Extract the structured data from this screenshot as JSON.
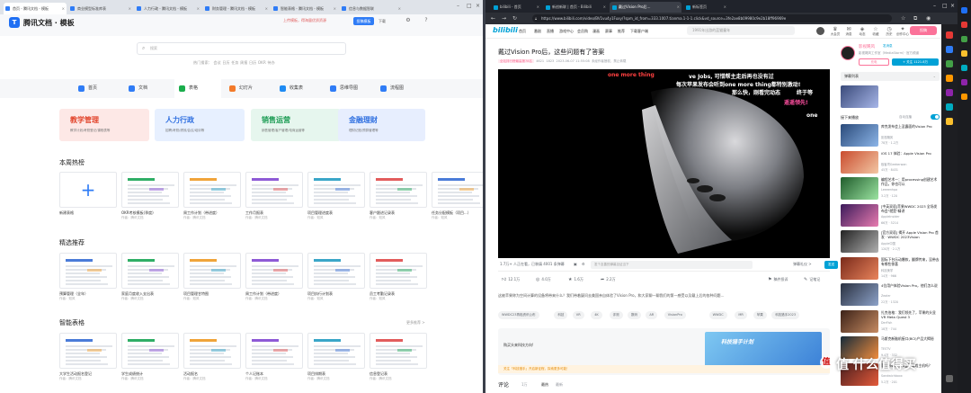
{
  "left_window": {
    "tabs": [
      {
        "label": "首页 - 腾讯文档 - 模板",
        "active": true
      },
      {
        "label": "商业模型标准库表",
        "active": false
      },
      {
        "label": "人力行政 - 腾讯文档 - 模板",
        "active": false
      },
      {
        "label": "财务管理 - 腾讯文档 - 模板",
        "active": false
      },
      {
        "label": "智能表格 - 腾讯文档 - 模板",
        "active": false
      },
      {
        "label": "信息与数据智联",
        "active": false
      }
    ],
    "app_name": "腾讯文档 · 模板",
    "header_hint": "上传模板，得海量优质资源",
    "submit_button": "投稿模板",
    "download_button": "下载",
    "search_placeholder": "搜索",
    "hot_searches": "热门搜索：  会议    日历    任务  周报   日历  OKR  待办",
    "categories": [
      {
        "label": "首页",
        "color": "#2f7cf6",
        "active": false
      },
      {
        "label": "文档",
        "color": "#2f7cf6",
        "active": false
      },
      {
        "label": "表格",
        "color": "#1aad4c",
        "active": true
      },
      {
        "label": "幻灯片",
        "color": "#f37a2a",
        "active": false
      },
      {
        "label": "收集表",
        "color": "#1f8bf3",
        "active": false
      },
      {
        "label": "思维导图",
        "color": "#2f7cf6",
        "active": false
      },
      {
        "label": "流程图",
        "color": "#2f7cf6",
        "active": false
      }
    ],
    "banners": [
      {
        "title": "教学管理",
        "sub": "教学计划/考勤登记/课程表等",
        "bg": "#fde8e6",
        "color": "#e2452c"
      },
      {
        "title": "人力行政",
        "sub": "招聘/考勤/绩效/会议/培训等",
        "bg": "#e7f0ff",
        "color": "#2f6fe0"
      },
      {
        "title": "销售运营",
        "sub": "销售管理/客户管理/电商运营等",
        "bg": "#e6f6ee",
        "color": "#1a9b52"
      },
      {
        "title": "金融理财",
        "sub": "理财记账/预算管理等",
        "bg": "#e7eefe",
        "color": "#2f6fe0"
      }
    ],
    "section_hot": "本周热榜",
    "hot_cards": [
      {
        "title": "新建表格",
        "meta": ""
      },
      {
        "title": "OKR考核模板(季度)",
        "meta": "作者：腾讯文档"
      },
      {
        "title": "周工作计划（带进度）",
        "meta": "作者：腾讯文档"
      },
      {
        "title": "工作月报表",
        "meta": "作者：腾讯文档"
      },
      {
        "title": "项目管理进度表",
        "meta": "作者：知风"
      },
      {
        "title": "客户跟进记录表",
        "meta": "作者：知风"
      },
      {
        "title": "任务分配模板（项目...）",
        "meta": "作者：知风"
      }
    ],
    "section_recommend": "精选推荐",
    "rec_cards": [
      {
        "title": "预算管理（全年）",
        "meta": "作者：知风"
      },
      {
        "title": "家庭月度收入支出表",
        "meta": "作者：腾讯文档"
      },
      {
        "title": "项目管理甘特图",
        "meta": "作者：知风"
      },
      {
        "title": "周工作计划（带进度）",
        "meta": "作者：腾讯文档"
      },
      {
        "title": "项目执行计划表",
        "meta": "作者：知风"
      },
      {
        "title": "员工考勤记录表",
        "meta": "作者：知风"
      }
    ],
    "section_smart": "智能表格",
    "more_link": "更多推荐 >",
    "smart_cards": [
      {
        "title": "大学生活动报名登记",
        "meta": "作者：腾讯文档"
      },
      {
        "title": "学生成绩统计",
        "meta": "作者：腾讯文档"
      },
      {
        "title": "活动报名",
        "meta": "作者：腾讯文档"
      },
      {
        "title": "个人记账本",
        "meta": "作者：腾讯文档"
      },
      {
        "title": "项目排期表",
        "meta": "作者：腾讯文档"
      },
      {
        "title": "信息登记表",
        "meta": "作者：腾讯文档"
      }
    ]
  },
  "right_window": {
    "tabs": [
      {
        "label": "bilibili - 首页",
        "active": false
      },
      {
        "label": "新创新联 | 首页 - Bilibili",
        "active": false
      },
      {
        "label": "戴过Vision Pro后…",
        "active": true
      },
      {
        "label": "新标签页",
        "active": false
      }
    ],
    "url": "https://www.bilibili.com/video/BV1vu4y1Fuxy/?spm_id_from=333.1007.tianma.1-1-1.click&vd_source=3fe2ae8b09980c9e2b18ff96969e",
    "logo": "bilibili",
    "nav_items": [
      "首页",
      "番剧",
      "直播",
      "游戏中心",
      "会员购",
      "漫画",
      "赛事",
      "推荐",
      "下载客户端"
    ],
    "search_placeholder": "1991年出游的蓝猫童年",
    "top_icons": [
      {
        "icon": "crown-icon",
        "label": "大会员"
      },
      {
        "icon": "message-icon",
        "label": "消息"
      },
      {
        "icon": "dynamic-icon",
        "label": "动态"
      },
      {
        "icon": "star-icon",
        "label": "收藏"
      },
      {
        "icon": "history-icon",
        "label": "历史"
      },
      {
        "icon": "bulb-icon",
        "label": "创作中心"
      }
    ],
    "upload_button": "投稿",
    "video": {
      "title": "戴过Vision Pro后，这些问题有了答案",
      "stats": "2023-06-07 11:55:08",
      "tag": "全站排行榜最高第78名",
      "views": "4621",
      "danmu": "1823",
      "no_repost": "未经作者授权，禁止转载"
    },
    "danmaku": [
      {
        "text": "one more thing",
        "color": "#ff4040"
      },
      {
        "text": "ve Jobs, 可惜帮主走后再也没有过",
        "color": "#ffffff"
      },
      {
        "text": "每次苹果发布会听到one more thing都特别激动!",
        "color": "#ffffff"
      },
      {
        "text": "那么快，刚看完动态",
        "color": "#ffffff"
      },
      {
        "text": "终于等",
        "color": "#ffffff"
      },
      {
        "text": "遥遥领先!",
        "color": "#ff4fa0"
      },
      {
        "text": "one",
        "color": "#ffffff"
      }
    ],
    "player_controls": {
      "watching": "1.7万+ 人正在看，已装填 4001 条弹幕",
      "input_placeholder": "发个友善的弹幕见证当下",
      "etiquette": "弹幕礼仪 >",
      "send": "发送"
    },
    "toolbar": [
      {
        "icon": "like-icon",
        "label": "12.1万"
      },
      {
        "icon": "coin-icon",
        "label": "4.0万"
      },
      {
        "icon": "fav-icon",
        "label": "1.6万"
      },
      {
        "icon": "share-icon",
        "label": "2.2万"
      },
      {
        "icon": "report-icon",
        "label": "稿件投诉"
      },
      {
        "icon": "note-icon",
        "label": "记笔记"
      }
    ],
    "description": "这被苹果称为空间计算的设备将带来什么？我们带着疑问去美国亲自体验了Vision Pro，和大家聊一聊我们的第一感受以及戴上后的各种问题…",
    "video_tags": [
      "WWDC23再临资讯公布",
      "科技",
      "VR",
      "4K",
      "评测",
      "数码",
      "AR",
      "VisionPro",
      "WWDC",
      "MR",
      "苹果",
      "科技猎手2023"
    ],
    "ad_text": "购买头来科技方向!",
    "ad_banner_title": "科技猎手计划",
    "notice": "关注「科技猎手」开启新征程，探索更多可能！",
    "comments_label": "评论",
    "comments_count": "1万",
    "comment_sort": [
      "最热",
      "最新"
    ],
    "up": {
      "name": "影视飓风",
      "extra": "发消息",
      "desc": "影视飓风工作室（MediaStorm）· 官方频道",
      "charge": "充电",
      "follow": "+ 关注 1121.8万"
    },
    "danmu_list_label": "弹幕列表",
    "rec_header": "接下来播放",
    "autoplay_label": "自动连播",
    "rec_videos": [
      {
        "title": "库克发布会上没露面的Vision Pro",
        "up": "影视飓风",
        "stats": "78万 · 1.2万",
        "c1": "#2a4a7a",
        "c2": "#8cb5e8"
      },
      {
        "title": "iOS 17 体验：Apple Vision Pro",
        "up": "极客湾Geekerwan",
        "stats": "45万 · 8431",
        "c1": "#c94c2e",
        "c2": "#f3c7a4"
      },
      {
        "title": "编程艺术一：用processing创建艺术作品，你也可以",
        "up": "Leeeenhpa",
        "stats": "3.2万 · 120",
        "c1": "#1f5c2b",
        "c2": "#9be3a1"
      },
      {
        "title": "[中英双语]苹果WWDC 2023 全场发布会\"就是\"精讲",
        "up": "AppleInsider",
        "stats": "66万 · 5214",
        "c1": "#3b1a5a",
        "c2": "#e87cb0"
      },
      {
        "title": "[官方双语] 揭开 Apple Vision Pro 首发 · WWDC 2023Vision",
        "up": "Apple中国",
        "stats": "120万 · 2.1万",
        "c1": "#222",
        "c2": "#b0b0b0"
      },
      {
        "title": "国际下台乐动爆款，翻牌传来，没带去有哪些惊喜",
        "up": "科技美学",
        "stats": "14万 · 966",
        "c1": "#7a2a1a",
        "c2": "#e9845c"
      },
      {
        "title": "4位用户体验Vision Pro，他们怎么说",
        "up": "Zealer",
        "stats": "22万 · 1320",
        "c1": "#293040",
        "c2": "#8da2c8"
      },
      {
        "title": "扎克伯格：我们领先了，苹果的头显 VR Meta Quest 3",
        "up": "DerFish",
        "stats": "18万 · 744",
        "c1": "#3c2218",
        "c2": "#c68b62"
      },
      {
        "title": "马斯克新脑机接口(BCI)产品大揭秘",
        "up": "TESTV",
        "stats": "9.4万 · 332",
        "c1": "#152a3a",
        "c2": "#f08c3c"
      },
      {
        "title": "苹果Vision Pro会是游戏主机吗？",
        "up": "Sandwichboxx",
        "stats": "5.2万 · 201",
        "c1": "#4a1e1e",
        "c2": "#e45a3a"
      }
    ]
  },
  "watermark": "值 什么值得买",
  "colors": {
    "bili_blue": "#00a1d6",
    "bili_pink": "#fb7299",
    "tencent_blue": "#2f7cf6"
  }
}
